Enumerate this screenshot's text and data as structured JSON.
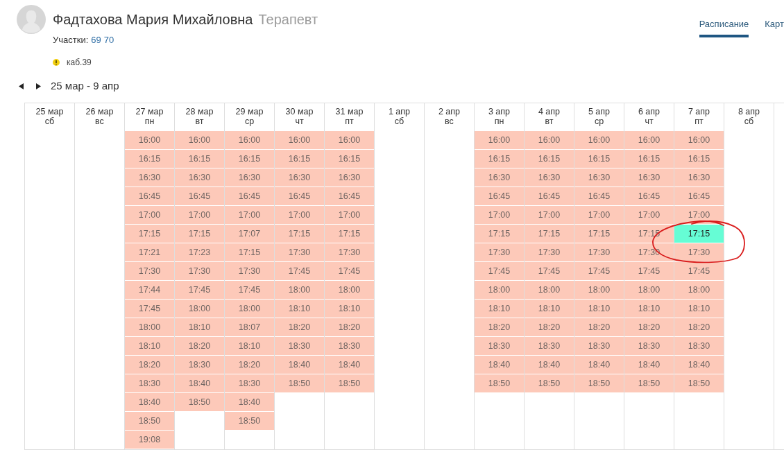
{
  "doctor": {
    "name": "Фадтахова Мария Михайловна",
    "specialty": "Терапевт"
  },
  "plots": {
    "label": "Участки:",
    "items": [
      "69",
      "70"
    ]
  },
  "room": {
    "text": "каб.39"
  },
  "tabs": [
    {
      "label": "Расписание",
      "selected": true
    },
    {
      "label": "Карт",
      "selected": false
    }
  ],
  "period": {
    "label": "25 мар - 9 апр"
  },
  "days": [
    {
      "date": "25 мар",
      "weekday": "сб"
    },
    {
      "date": "26 мар",
      "weekday": "вс"
    },
    {
      "date": "27 мар",
      "weekday": "пн",
      "slots": [
        {
          "time": "16:00",
          "selected": false
        },
        {
          "time": "16:15",
          "selected": false
        },
        {
          "time": "16:30",
          "selected": false
        },
        {
          "time": "16:45",
          "selected": false
        },
        {
          "time": "17:00",
          "selected": false
        },
        {
          "time": "17:15",
          "selected": false
        },
        {
          "time": "17:21",
          "selected": false
        },
        {
          "time": "17:30",
          "selected": false
        },
        {
          "time": "17:44",
          "selected": false
        },
        {
          "time": "17:45",
          "selected": false
        },
        {
          "time": "18:00",
          "selected": false
        },
        {
          "time": "18:10",
          "selected": false
        },
        {
          "time": "18:20",
          "selected": false
        },
        {
          "time": "18:30",
          "selected": false
        },
        {
          "time": "18:40",
          "selected": false
        },
        {
          "time": "18:50",
          "selected": false
        },
        {
          "time": "19:08",
          "selected": false
        }
      ]
    },
    {
      "date": "28 мар",
      "weekday": "вт",
      "slots": [
        {
          "time": "16:00",
          "selected": false
        },
        {
          "time": "16:15",
          "selected": false
        },
        {
          "time": "16:30",
          "selected": false
        },
        {
          "time": "16:45",
          "selected": false
        },
        {
          "time": "17:00",
          "selected": false
        },
        {
          "time": "17:15",
          "selected": false
        },
        {
          "time": "17:23",
          "selected": false
        },
        {
          "time": "17:30",
          "selected": false
        },
        {
          "time": "17:45",
          "selected": false
        },
        {
          "time": "18:00",
          "selected": false
        },
        {
          "time": "18:10",
          "selected": false
        },
        {
          "time": "18:20",
          "selected": false
        },
        {
          "time": "18:30",
          "selected": false
        },
        {
          "time": "18:40",
          "selected": false
        },
        {
          "time": "18:50",
          "selected": false
        }
      ]
    },
    {
      "date": "29 мар",
      "weekday": "ср",
      "slots": [
        {
          "time": "16:00",
          "selected": false
        },
        {
          "time": "16:15",
          "selected": false
        },
        {
          "time": "16:30",
          "selected": false
        },
        {
          "time": "16:45",
          "selected": false
        },
        {
          "time": "17:00",
          "selected": false
        },
        {
          "time": "17:07",
          "selected": false
        },
        {
          "time": "17:15",
          "selected": false
        },
        {
          "time": "17:30",
          "selected": false
        },
        {
          "time": "17:45",
          "selected": false
        },
        {
          "time": "18:00",
          "selected": false
        },
        {
          "time": "18:07",
          "selected": false
        },
        {
          "time": "18:10",
          "selected": false
        },
        {
          "time": "18:20",
          "selected": false
        },
        {
          "time": "18:30",
          "selected": false
        },
        {
          "time": "18:40",
          "selected": false
        },
        {
          "time": "18:50",
          "selected": false
        }
      ]
    },
    {
      "date": "30 мар",
      "weekday": "чт",
      "slots": [
        {
          "time": "16:00",
          "selected": false
        },
        {
          "time": "16:15",
          "selected": false
        },
        {
          "time": "16:30",
          "selected": false
        },
        {
          "time": "16:45",
          "selected": false
        },
        {
          "time": "17:00",
          "selected": false
        },
        {
          "time": "17:15",
          "selected": false
        },
        {
          "time": "17:30",
          "selected": false
        },
        {
          "time": "17:45",
          "selected": false
        },
        {
          "time": "18:00",
          "selected": false
        },
        {
          "time": "18:10",
          "selected": false
        },
        {
          "time": "18:20",
          "selected": false
        },
        {
          "time": "18:30",
          "selected": false
        },
        {
          "time": "18:40",
          "selected": false
        },
        {
          "time": "18:50",
          "selected": false
        }
      ]
    },
    {
      "date": "31 мар",
      "weekday": "пт",
      "slots": [
        {
          "time": "16:00",
          "selected": false
        },
        {
          "time": "16:15",
          "selected": false
        },
        {
          "time": "16:30",
          "selected": false
        },
        {
          "time": "16:45",
          "selected": false
        },
        {
          "time": "17:00",
          "selected": false
        },
        {
          "time": "17:15",
          "selected": false
        },
        {
          "time": "17:30",
          "selected": false
        },
        {
          "time": "17:45",
          "selected": false
        },
        {
          "time": "18:00",
          "selected": false
        },
        {
          "time": "18:10",
          "selected": false
        },
        {
          "time": "18:20",
          "selected": false
        },
        {
          "time": "18:30",
          "selected": false
        },
        {
          "time": "18:40",
          "selected": false
        },
        {
          "time": "18:50",
          "selected": false
        }
      ]
    },
    {
      "date": "1 апр",
      "weekday": "сб"
    },
    {
      "date": "2 апр",
      "weekday": "вс"
    },
    {
      "date": "3 апр",
      "weekday": "пн",
      "slots": [
        {
          "time": "16:00",
          "selected": false
        },
        {
          "time": "16:15",
          "selected": false
        },
        {
          "time": "16:30",
          "selected": false
        },
        {
          "time": "16:45",
          "selected": false
        },
        {
          "time": "17:00",
          "selected": false
        },
        {
          "time": "17:15",
          "selected": false
        },
        {
          "time": "17:30",
          "selected": false
        },
        {
          "time": "17:45",
          "selected": false
        },
        {
          "time": "18:00",
          "selected": false
        },
        {
          "time": "18:10",
          "selected": false
        },
        {
          "time": "18:20",
          "selected": false
        },
        {
          "time": "18:30",
          "selected": false
        },
        {
          "time": "18:40",
          "selected": false
        },
        {
          "time": "18:50",
          "selected": false
        }
      ]
    },
    {
      "date": "4 апр",
      "weekday": "вт",
      "slots": [
        {
          "time": "16:00",
          "selected": false
        },
        {
          "time": "16:15",
          "selected": false
        },
        {
          "time": "16:30",
          "selected": false
        },
        {
          "time": "16:45",
          "selected": false
        },
        {
          "time": "17:00",
          "selected": false
        },
        {
          "time": "17:15",
          "selected": false
        },
        {
          "time": "17:30",
          "selected": false
        },
        {
          "time": "17:45",
          "selected": false
        },
        {
          "time": "18:00",
          "selected": false
        },
        {
          "time": "18:10",
          "selected": false
        },
        {
          "time": "18:20",
          "selected": false
        },
        {
          "time": "18:30",
          "selected": false
        },
        {
          "time": "18:40",
          "selected": false
        },
        {
          "time": "18:50",
          "selected": false
        }
      ]
    },
    {
      "date": "5 апр",
      "weekday": "ср",
      "slots": [
        {
          "time": "16:00",
          "selected": false
        },
        {
          "time": "16:15",
          "selected": false
        },
        {
          "time": "16:30",
          "selected": false
        },
        {
          "time": "16:45",
          "selected": false
        },
        {
          "time": "17:00",
          "selected": false
        },
        {
          "time": "17:15",
          "selected": false
        },
        {
          "time": "17:30",
          "selected": false
        },
        {
          "time": "17:45",
          "selected": false
        },
        {
          "time": "18:00",
          "selected": false
        },
        {
          "time": "18:10",
          "selected": false
        },
        {
          "time": "18:20",
          "selected": false
        },
        {
          "time": "18:30",
          "selected": false
        },
        {
          "time": "18:40",
          "selected": false
        },
        {
          "time": "18:50",
          "selected": false
        }
      ]
    },
    {
      "date": "6 апр",
      "weekday": "чт",
      "slots": [
        {
          "time": "16:00",
          "selected": false
        },
        {
          "time": "16:15",
          "selected": false
        },
        {
          "time": "16:30",
          "selected": false
        },
        {
          "time": "16:45",
          "selected": false
        },
        {
          "time": "17:00",
          "selected": false
        },
        {
          "time": "17:15",
          "selected": false
        },
        {
          "time": "17:30",
          "selected": false
        },
        {
          "time": "17:45",
          "selected": false
        },
        {
          "time": "18:00",
          "selected": false
        },
        {
          "time": "18:10",
          "selected": false
        },
        {
          "time": "18:20",
          "selected": false
        },
        {
          "time": "18:30",
          "selected": false
        },
        {
          "time": "18:40",
          "selected": false
        },
        {
          "time": "18:50",
          "selected": false
        }
      ]
    },
    {
      "date": "7 апр",
      "weekday": "пт",
      "slots": [
        {
          "time": "16:00",
          "selected": false
        },
        {
          "time": "16:15",
          "selected": false
        },
        {
          "time": "16:30",
          "selected": false
        },
        {
          "time": "16:45",
          "selected": false
        },
        {
          "time": "17:00",
          "selected": false
        },
        {
          "time": "17:15",
          "selected": true
        },
        {
          "time": "17:30",
          "selected": false
        },
        {
          "time": "17:45",
          "selected": false
        },
        {
          "time": "18:00",
          "selected": false
        },
        {
          "time": "18:10",
          "selected": false
        },
        {
          "time": "18:20",
          "selected": false
        },
        {
          "time": "18:30",
          "selected": false
        },
        {
          "time": "18:40",
          "selected": false
        },
        {
          "time": "18:50",
          "selected": false
        }
      ]
    },
    {
      "date": "8 апр",
      "weekday": "сб"
    }
  ],
  "annotation": {
    "kind": "ellipse"
  }
}
